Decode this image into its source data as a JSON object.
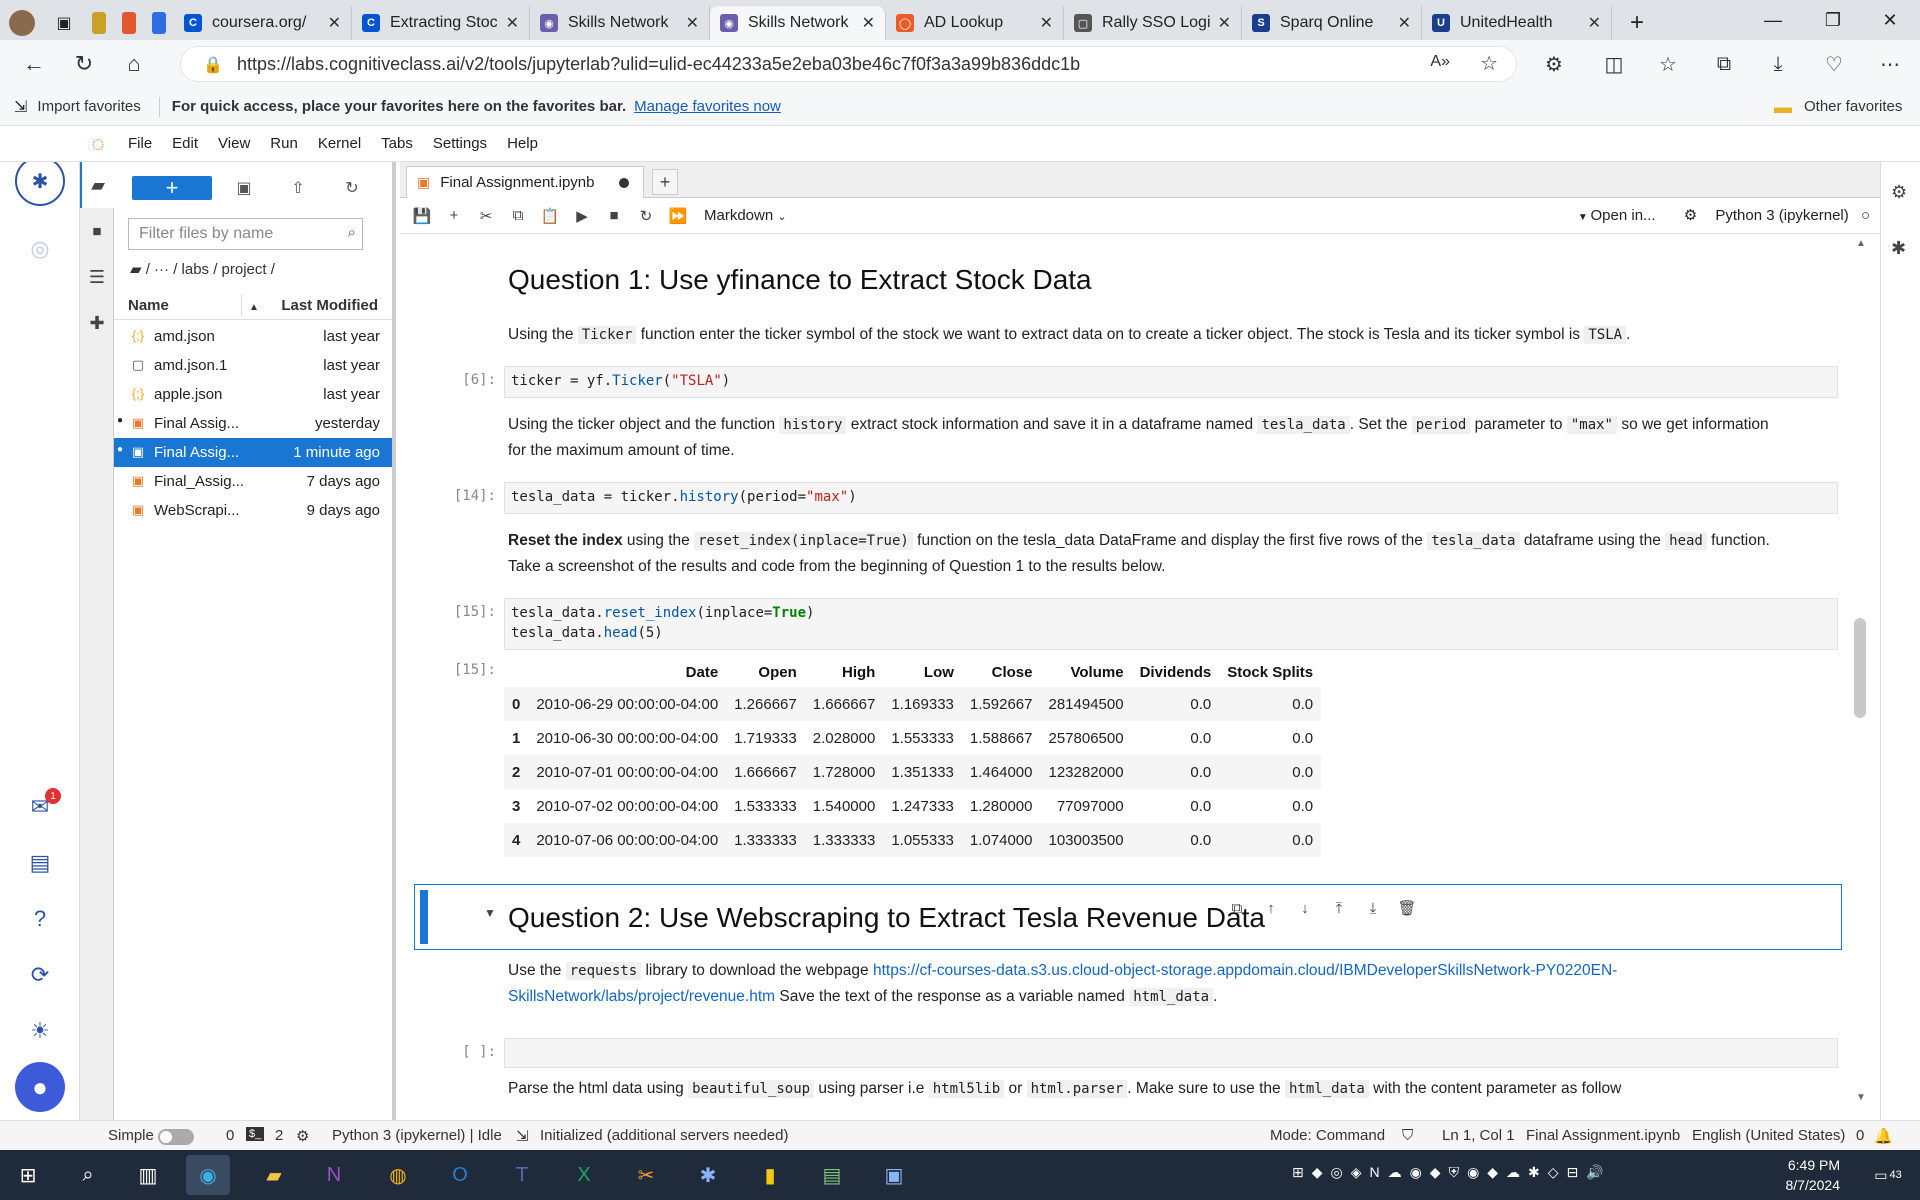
{
  "browser": {
    "tabs": [
      {
        "title": "coursera.org/",
        "favicon_color": "#0056d2",
        "favicon": "C"
      },
      {
        "title": "Extracting Stoc",
        "favicon_color": "#0056d2",
        "favicon": "C"
      },
      {
        "title": "Skills Network",
        "favicon_color": "#6b5fad",
        "favicon": "◉"
      },
      {
        "title": "Skills Network",
        "favicon_color": "#6b5fad",
        "favicon": "◉",
        "active": true
      },
      {
        "title": "AD Lookup",
        "favicon_color": "#f05a28",
        "favicon": "◯"
      },
      {
        "title": "Rally SSO Logi",
        "favicon_color": "#555555",
        "favicon": "▢"
      },
      {
        "title": "Sparq Online",
        "favicon_color": "#1a3e8c",
        "favicon": "S"
      },
      {
        "title": "UnitedHealth",
        "favicon_color": "#1a3e8c",
        "favicon": "U"
      }
    ],
    "url": "https://labs.cognitiveclass.ai/v2/tools/jupyterlab?ulid=ulid-ec44233a5e2eba03be46c7f0f3a3a99b836ddc1b",
    "favorites_bar": {
      "import_label": "Import favorites",
      "hint": "For quick access, place your favorites here on the favorites bar.",
      "link": "Manage favorites now",
      "other": "Other favorites"
    }
  },
  "jupyter": {
    "menu": [
      "File",
      "Edit",
      "View",
      "Run",
      "Kernel",
      "Tabs",
      "Settings",
      "Help"
    ],
    "filter_placeholder": "Filter files by name",
    "breadcrumb": "/ ··· / labs / project /",
    "file_headers": {
      "name": "Name",
      "modified": "Last Modified"
    },
    "files": [
      {
        "name": "amd.json",
        "modified": "last year",
        "icon": "{;}",
        "icon_color": "#f5a623"
      },
      {
        "name": "amd.json.1",
        "modified": "last year",
        "icon": "▢",
        "icon_color": "#555555"
      },
      {
        "name": "apple.json",
        "modified": "last year",
        "icon": "{;}",
        "icon_color": "#f5a623"
      },
      {
        "name": "Final Assig...",
        "modified": "yesterday",
        "icon": "▣",
        "icon_color": "#f37626",
        "dot": true
      },
      {
        "name": "Final Assig...",
        "modified": "1 minute ago",
        "icon": "▣",
        "icon_color": "#ffffff",
        "dot": true,
        "selected": true
      },
      {
        "name": "Final_Assig...",
        "modified": "7 days ago",
        "icon": "▣",
        "icon_color": "#f37626"
      },
      {
        "name": "WebScrapi...",
        "modified": "9 days ago",
        "icon": "▣",
        "icon_color": "#f37626"
      }
    ],
    "notebook_tab": "Final Assignment.ipynb",
    "cell_type": "Markdown",
    "open_in": "Open in...",
    "kernel": "Python 3 (ipykernel)"
  },
  "notebook": {
    "q1_title": "Question 1: Use yfinance to Extract Stock Data",
    "q1_text_a": "Using the",
    "q1_code_ticker": "Ticker",
    "q1_text_b": "function enter the ticker symbol of the stock we want to extract data on to create a ticker object. The stock is Tesla and its ticker symbol is",
    "q1_code_tsla": "TSLA",
    "cell6_prompt": "[6]:",
    "cell14_prompt": "[14]:",
    "cell15_prompt": "[15]:",
    "out15_prompt": "[15]:",
    "md2_a": "Using the ticker object and the function",
    "md2_code1": "history",
    "md2_b": "extract stock information and save it in a dataframe named",
    "md2_code2": "tesla_data",
    "md2_c": ". Set the",
    "md2_code3": "period",
    "md2_d": "parameter to",
    "md2_code4": "\"max\"",
    "md2_e": "so we get information",
    "md2_f": "for the maximum amount of time.",
    "md3_bold": "Reset the index",
    "md3_a": "using the",
    "md3_code1": "reset_index(inplace=True)",
    "md3_b": "function on the tesla_data DataFrame and display the first five rows of the",
    "md3_code2": "tesla_data",
    "md3_c": "dataframe using the",
    "md3_code3": "head",
    "md3_d": "function.",
    "md3_e": "Take a screenshot of the results and code from the beginning of Question 1 to the results below.",
    "df_columns": [
      "",
      "Date",
      "Open",
      "High",
      "Low",
      "Close",
      "Volume",
      "Dividends",
      "Stock Splits"
    ],
    "df_rows": [
      [
        "0",
        "2010-06-29 00:00:00-04:00",
        "1.266667",
        "1.666667",
        "1.169333",
        "1.592667",
        "281494500",
        "0.0",
        "0.0"
      ],
      [
        "1",
        "2010-06-30 00:00:00-04:00",
        "1.719333",
        "2.028000",
        "1.553333",
        "1.588667",
        "257806500",
        "0.0",
        "0.0"
      ],
      [
        "2",
        "2010-07-01 00:00:00-04:00",
        "1.666667",
        "1.728000",
        "1.351333",
        "1.464000",
        "123282000",
        "0.0",
        "0.0"
      ],
      [
        "3",
        "2010-07-02 00:00:00-04:00",
        "1.533333",
        "1.540000",
        "1.247333",
        "1.280000",
        "77097000",
        "0.0",
        "0.0"
      ],
      [
        "4",
        "2010-07-06 00:00:00-04:00",
        "1.333333",
        "1.333333",
        "1.055333",
        "1.074000",
        "103003500",
        "0.0",
        "0.0"
      ]
    ],
    "q2_title": "Question 2: Use Webscraping to Extract Tesla Revenue Data",
    "q2_a": "Use the",
    "q2_code1": "requests",
    "q2_b": "library to download the webpage",
    "q2_link1": "https://cf-courses-data.s3.us.cloud-object-storage.appdomain.cloud/IBMDeveloperSkillsNetwork-PY0220EN-",
    "q2_link2": "SkillsNetwork/labs/project/revenue.htm",
    "q2_c": "Save the text of the response as a variable named",
    "q2_code2": "html_data",
    "empty_prompt": "[ ]:",
    "q2_parse_a": "Parse the html data using",
    "q2_parse_c1": "beautiful_soup",
    "q2_parse_b": "using parser i.e",
    "q2_parse_c2": "html5lib",
    "q2_parse_or": "or",
    "q2_parse_c3": "html.parser",
    "q2_parse_d": ". Make sure to use the",
    "q2_parse_c4": "html_data",
    "q2_parse_e": "with the content parameter as follow"
  },
  "status": {
    "simple": "Simple",
    "zero": "0",
    "two": "2",
    "kernel": "Python 3 (ipykernel) | Idle",
    "init": "Initialized (additional servers needed)",
    "mode": "Mode: Command",
    "pos": "Ln 1, Col 1",
    "file": "Final Assignment.ipynb",
    "lang": "English (United States)",
    "notif": "0"
  },
  "taskbar": {
    "time": "6:49 PM",
    "date": "8/7/2024",
    "badge": "43"
  }
}
